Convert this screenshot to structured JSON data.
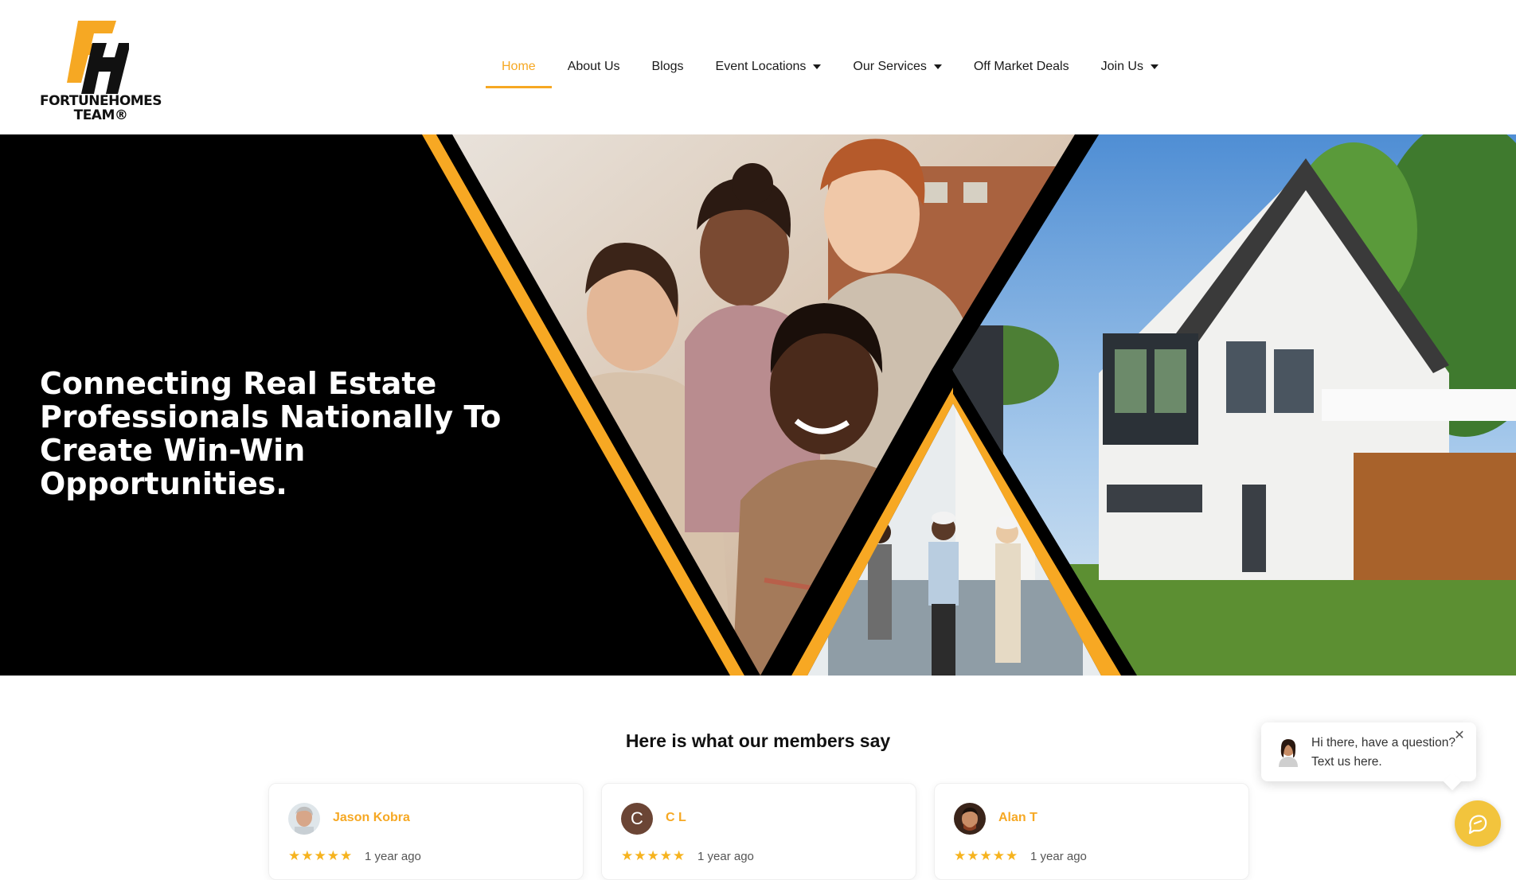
{
  "brand": {
    "monogram": "FH",
    "name_line1": "FORTUNEHOMES",
    "name_line2": "TEAM®",
    "accent_color": "#f6a823"
  },
  "nav": {
    "items": [
      {
        "label": "Home",
        "active": true,
        "has_dropdown": false
      },
      {
        "label": "About Us",
        "active": false,
        "has_dropdown": false
      },
      {
        "label": "Blogs",
        "active": false,
        "has_dropdown": false
      },
      {
        "label": "Event Locations",
        "active": false,
        "has_dropdown": true
      },
      {
        "label": "Our Services",
        "active": false,
        "has_dropdown": true
      },
      {
        "label": "Off Market Deals",
        "active": false,
        "has_dropdown": false
      },
      {
        "label": "Join Us",
        "active": false,
        "has_dropdown": true
      }
    ]
  },
  "hero": {
    "title": "Connecting Real Estate Professionals Nationally To Create Win-Win Opportunities."
  },
  "reviews": {
    "heading": "Here is what our members say",
    "items": [
      {
        "name": "Jason Kobra",
        "avatar": "photo",
        "stars": "★★★★★",
        "rating": 5,
        "time": "1 year ago"
      },
      {
        "name": "C L",
        "avatar": "C",
        "stars": "★★★★★",
        "rating": 5,
        "time": "1 year ago"
      },
      {
        "name": "Alan T",
        "avatar": "photo",
        "stars": "★★★★★",
        "rating": 5,
        "time": "1 year ago"
      }
    ]
  },
  "chat": {
    "message": "Hi there, have a question? Text us here.",
    "close_icon": "close-icon",
    "button_icon": "chat-bubble-icon",
    "button_color": "#f2c43d"
  }
}
